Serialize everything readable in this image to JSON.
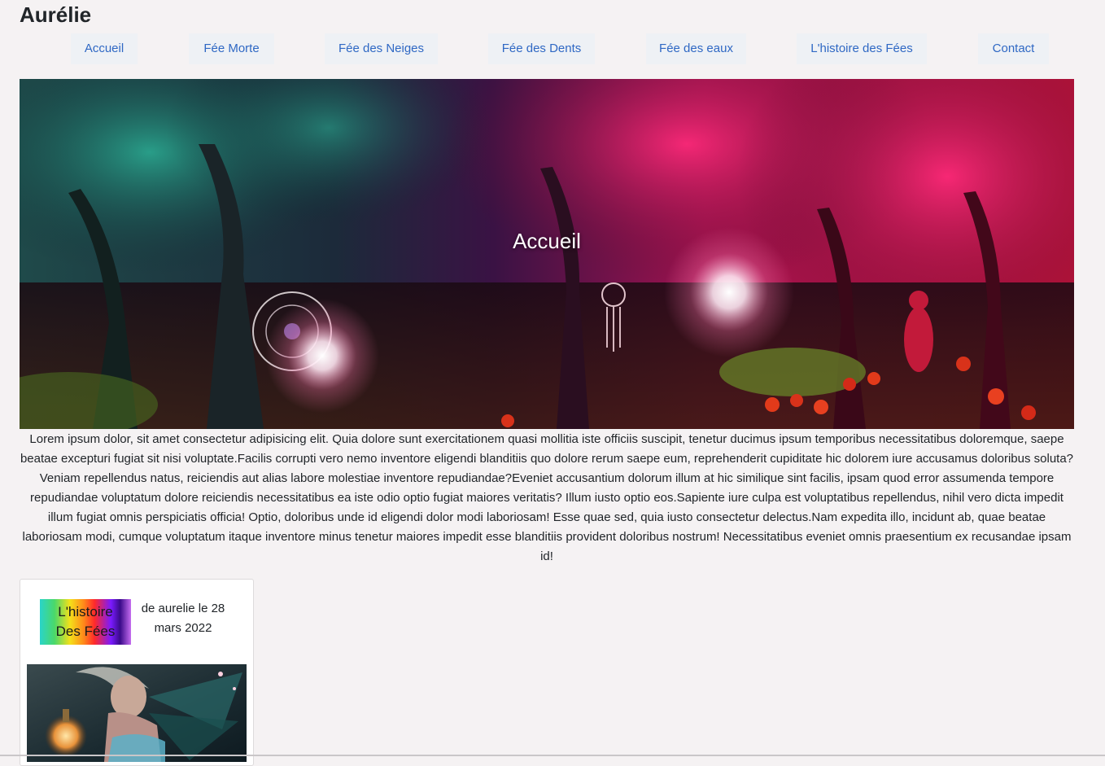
{
  "site": {
    "title": "Aurélie"
  },
  "nav": {
    "items": [
      {
        "label": "Accueil"
      },
      {
        "label": "Fée Morte"
      },
      {
        "label": "Fée des Neiges"
      },
      {
        "label": "Fée des Dents"
      },
      {
        "label": "Fée des eaux"
      },
      {
        "label": "L'histoire des Fées"
      },
      {
        "label": "Contact"
      }
    ]
  },
  "hero": {
    "title": "Accueil"
  },
  "intro": {
    "text": "Lorem ipsum dolor, sit amet consectetur adipisicing elit. Quia dolore sunt exercitationem quasi mollitia iste officiis suscipit, tenetur ducimus ipsum temporibus necessitatibus doloremque, saepe beatae excepturi fugiat sit nisi voluptate.Facilis corrupti vero nemo inventore eligendi blanditiis quo dolore rerum saepe eum, reprehenderit cupiditate hic dolorem iure accusamus doloribus soluta? Veniam repellendus natus, reiciendis aut alias labore molestiae inventore repudiandae?Eveniet accusantium dolorum illum at hic similique sint facilis, ipsam quod error assumenda tempore repudiandae voluptatum dolore reiciendis necessitatibus ea iste odio optio fugiat maiores veritatis? Illum iusto optio eos.Sapiente iure culpa est voluptatibus repellendus, nihil vero dicta impedit illum fugiat omnis perspiciatis officia! Optio, doloribus unde id eligendi dolor modi laboriosam! Esse quae sed, quia iusto consectetur delectus.Nam expedita illo, incidunt ab, quae beatae laboriosam modi, cumque voluptatum itaque inventore minus tenetur maiores impedit esse blanditiis provident doloribus nostrum! Necessitatibus eveniet omnis praesentium ex recusandae ipsam id!"
  },
  "card": {
    "logo_line1": "L'histoire",
    "logo_line2": "Des Fées",
    "meta": "de aurelie le 28 mars 2022"
  }
}
